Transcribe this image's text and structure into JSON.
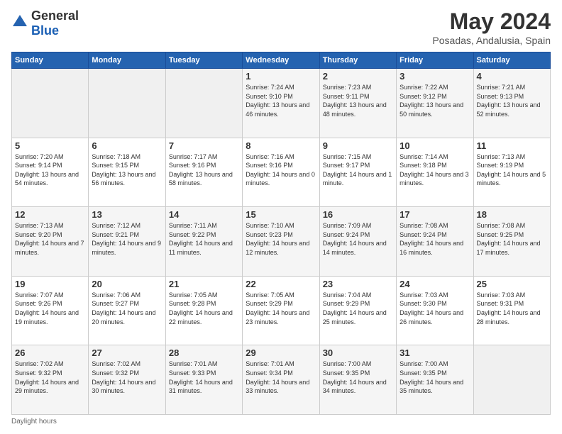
{
  "logo": {
    "general": "General",
    "blue": "Blue"
  },
  "title": "May 2024",
  "subtitle": "Posadas, Andalusia, Spain",
  "header": {
    "days": [
      "Sunday",
      "Monday",
      "Tuesday",
      "Wednesday",
      "Thursday",
      "Friday",
      "Saturday"
    ]
  },
  "weeks": [
    [
      {
        "day": "",
        "empty": true
      },
      {
        "day": "",
        "empty": true
      },
      {
        "day": "",
        "empty": true
      },
      {
        "day": "1",
        "sunrise": "7:24 AM",
        "sunset": "9:10 PM",
        "daylight": "13 hours and 46 minutes."
      },
      {
        "day": "2",
        "sunrise": "7:23 AM",
        "sunset": "9:11 PM",
        "daylight": "13 hours and 48 minutes."
      },
      {
        "day": "3",
        "sunrise": "7:22 AM",
        "sunset": "9:12 PM",
        "daylight": "13 hours and 50 minutes."
      },
      {
        "day": "4",
        "sunrise": "7:21 AM",
        "sunset": "9:13 PM",
        "daylight": "13 hours and 52 minutes."
      }
    ],
    [
      {
        "day": "5",
        "sunrise": "7:20 AM",
        "sunset": "9:14 PM",
        "daylight": "13 hours and 54 minutes."
      },
      {
        "day": "6",
        "sunrise": "7:18 AM",
        "sunset": "9:15 PM",
        "daylight": "13 hours and 56 minutes."
      },
      {
        "day": "7",
        "sunrise": "7:17 AM",
        "sunset": "9:16 PM",
        "daylight": "13 hours and 58 minutes."
      },
      {
        "day": "8",
        "sunrise": "7:16 AM",
        "sunset": "9:16 PM",
        "daylight": "14 hours and 0 minutes."
      },
      {
        "day": "9",
        "sunrise": "7:15 AM",
        "sunset": "9:17 PM",
        "daylight": "14 hours and 1 minute."
      },
      {
        "day": "10",
        "sunrise": "7:14 AM",
        "sunset": "9:18 PM",
        "daylight": "14 hours and 3 minutes."
      },
      {
        "day": "11",
        "sunrise": "7:13 AM",
        "sunset": "9:19 PM",
        "daylight": "14 hours and 5 minutes."
      }
    ],
    [
      {
        "day": "12",
        "sunrise": "7:13 AM",
        "sunset": "9:20 PM",
        "daylight": "14 hours and 7 minutes."
      },
      {
        "day": "13",
        "sunrise": "7:12 AM",
        "sunset": "9:21 PM",
        "daylight": "14 hours and 9 minutes."
      },
      {
        "day": "14",
        "sunrise": "7:11 AM",
        "sunset": "9:22 PM",
        "daylight": "14 hours and 11 minutes."
      },
      {
        "day": "15",
        "sunrise": "7:10 AM",
        "sunset": "9:23 PM",
        "daylight": "14 hours and 12 minutes."
      },
      {
        "day": "16",
        "sunrise": "7:09 AM",
        "sunset": "9:24 PM",
        "daylight": "14 hours and 14 minutes."
      },
      {
        "day": "17",
        "sunrise": "7:08 AM",
        "sunset": "9:24 PM",
        "daylight": "14 hours and 16 minutes."
      },
      {
        "day": "18",
        "sunrise": "7:08 AM",
        "sunset": "9:25 PM",
        "daylight": "14 hours and 17 minutes."
      }
    ],
    [
      {
        "day": "19",
        "sunrise": "7:07 AM",
        "sunset": "9:26 PM",
        "daylight": "14 hours and 19 minutes."
      },
      {
        "day": "20",
        "sunrise": "7:06 AM",
        "sunset": "9:27 PM",
        "daylight": "14 hours and 20 minutes."
      },
      {
        "day": "21",
        "sunrise": "7:05 AM",
        "sunset": "9:28 PM",
        "daylight": "14 hours and 22 minutes."
      },
      {
        "day": "22",
        "sunrise": "7:05 AM",
        "sunset": "9:29 PM",
        "daylight": "14 hours and 23 minutes."
      },
      {
        "day": "23",
        "sunrise": "7:04 AM",
        "sunset": "9:29 PM",
        "daylight": "14 hours and 25 minutes."
      },
      {
        "day": "24",
        "sunrise": "7:03 AM",
        "sunset": "9:30 PM",
        "daylight": "14 hours and 26 minutes."
      },
      {
        "day": "25",
        "sunrise": "7:03 AM",
        "sunset": "9:31 PM",
        "daylight": "14 hours and 28 minutes."
      }
    ],
    [
      {
        "day": "26",
        "sunrise": "7:02 AM",
        "sunset": "9:32 PM",
        "daylight": "14 hours and 29 minutes."
      },
      {
        "day": "27",
        "sunrise": "7:02 AM",
        "sunset": "9:32 PM",
        "daylight": "14 hours and 30 minutes."
      },
      {
        "day": "28",
        "sunrise": "7:01 AM",
        "sunset": "9:33 PM",
        "daylight": "14 hours and 31 minutes."
      },
      {
        "day": "29",
        "sunrise": "7:01 AM",
        "sunset": "9:34 PM",
        "daylight": "14 hours and 33 minutes."
      },
      {
        "day": "30",
        "sunrise": "7:00 AM",
        "sunset": "9:35 PM",
        "daylight": "14 hours and 34 minutes."
      },
      {
        "day": "31",
        "sunrise": "7:00 AM",
        "sunset": "9:35 PM",
        "daylight": "14 hours and 35 minutes."
      },
      {
        "day": "",
        "empty": true
      }
    ]
  ],
  "footer": {
    "daylight_label": "Daylight hours"
  }
}
